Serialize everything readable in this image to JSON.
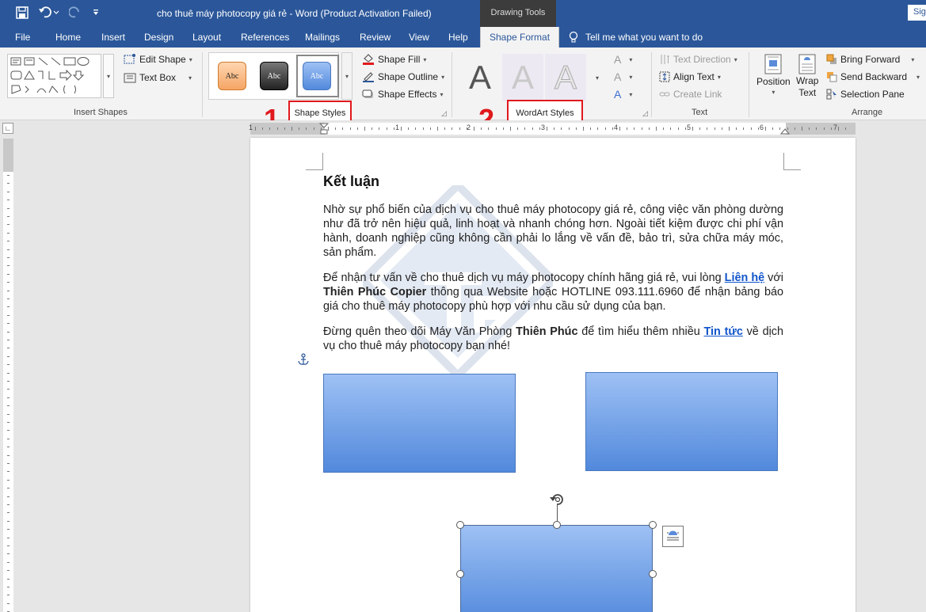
{
  "titlebar": {
    "doc_title": "cho thuê máy photocopy giá rẻ  -  Word (Product Activation Failed)",
    "context_title": "Drawing Tools",
    "signin": "Sig"
  },
  "tabs": [
    "File",
    "Home",
    "Insert",
    "Design",
    "Layout",
    "References",
    "Mailings",
    "Review",
    "View",
    "Help",
    "Shape Format"
  ],
  "active_tab": "Shape Format",
  "tell_me": "Tell me what you want to do",
  "ribbon": {
    "insert_shapes": {
      "edit_shape": "Edit Shape",
      "text_box": "Text Box",
      "label": "Insert Shapes"
    },
    "shape_styles": {
      "swatch_text": "Abc",
      "fill": "Shape Fill",
      "outline": "Shape Outline",
      "effects": "Shape Effects",
      "label": "Shape Styles"
    },
    "wordart_styles": {
      "letter": "A",
      "label": "WordArt Styles"
    },
    "text": {
      "direction": "Text Direction",
      "align": "Align Text",
      "link": "Create Link",
      "label": "Text"
    },
    "arrange": {
      "position": "Position",
      "wrap": "Wrap",
      "wrap2": "Text",
      "bring": "Bring Forward",
      "send": "Send Backward",
      "pane": "Selection Pane",
      "label": "Arrange"
    }
  },
  "annotations": [
    "1",
    "2"
  ],
  "ruler_numbers": [
    "1",
    "1",
    "2",
    "3",
    "4",
    "5",
    "6",
    "7"
  ],
  "document": {
    "heading": "Kết luận",
    "p1": "Nhờ sự phổ biến của dịch vụ cho thuê máy photocopy giá rẻ, công việc văn phòng dường như đã trở nên hiệu quả, linh hoạt và nhanh chóng hơn. Ngoài tiết kiệm được chi phí vận hành, doanh nghiệp cũng không cần phải lo lắng về vấn đề, bảo trì, sửa chữa máy móc, sản phẩm.",
    "p2_a": "Để nhận tư vấn về cho thuê dịch vụ máy photocopy chính hãng giá rẻ, vui lòng ",
    "p2_link": "Liên hệ",
    "p2_b": " với ",
    "p2_bold": "Thiên Phúc Copier",
    "p2_c": " thông qua Website hoặc HOTLINE 093.111.6960 để nhận bảng báo giá cho thuê máy photocopy phù hợp với nhu cầu sử dụng của bạn.",
    "p3_a": "Đừng quên theo dõi Máy Văn Phòng ",
    "p3_bold": "Thiên Phúc",
    "p3_b": " để tìm hiểu thêm nhiều ",
    "p3_link": "Tin tức",
    "p3_c": " về dịch vụ cho thuê máy photocopy bạn nhé!"
  },
  "colors": {
    "word_blue": "#2b579a",
    "annotation_red": "#e0191d",
    "shape_fill_top": "#9ec1f4",
    "shape_fill_bottom": "#5289dc"
  }
}
